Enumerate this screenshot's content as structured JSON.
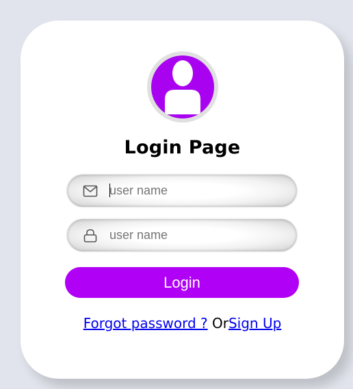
{
  "page": {
    "title": "Login Page"
  },
  "avatar": {
    "icon": "user-icon",
    "color": "#a902f0"
  },
  "username_field": {
    "icon": "envelope-icon",
    "placeholder": "user name",
    "value": ""
  },
  "password_field": {
    "icon": "lock-icon",
    "placeholder": "user name",
    "value": ""
  },
  "login_button": {
    "label": "Login",
    "color": "#b000f6"
  },
  "footer": {
    "forgot_label": "Forgot password ?",
    "or_label": "Or",
    "signup_label": "Sign Up",
    "link_color": "#0000ee"
  }
}
